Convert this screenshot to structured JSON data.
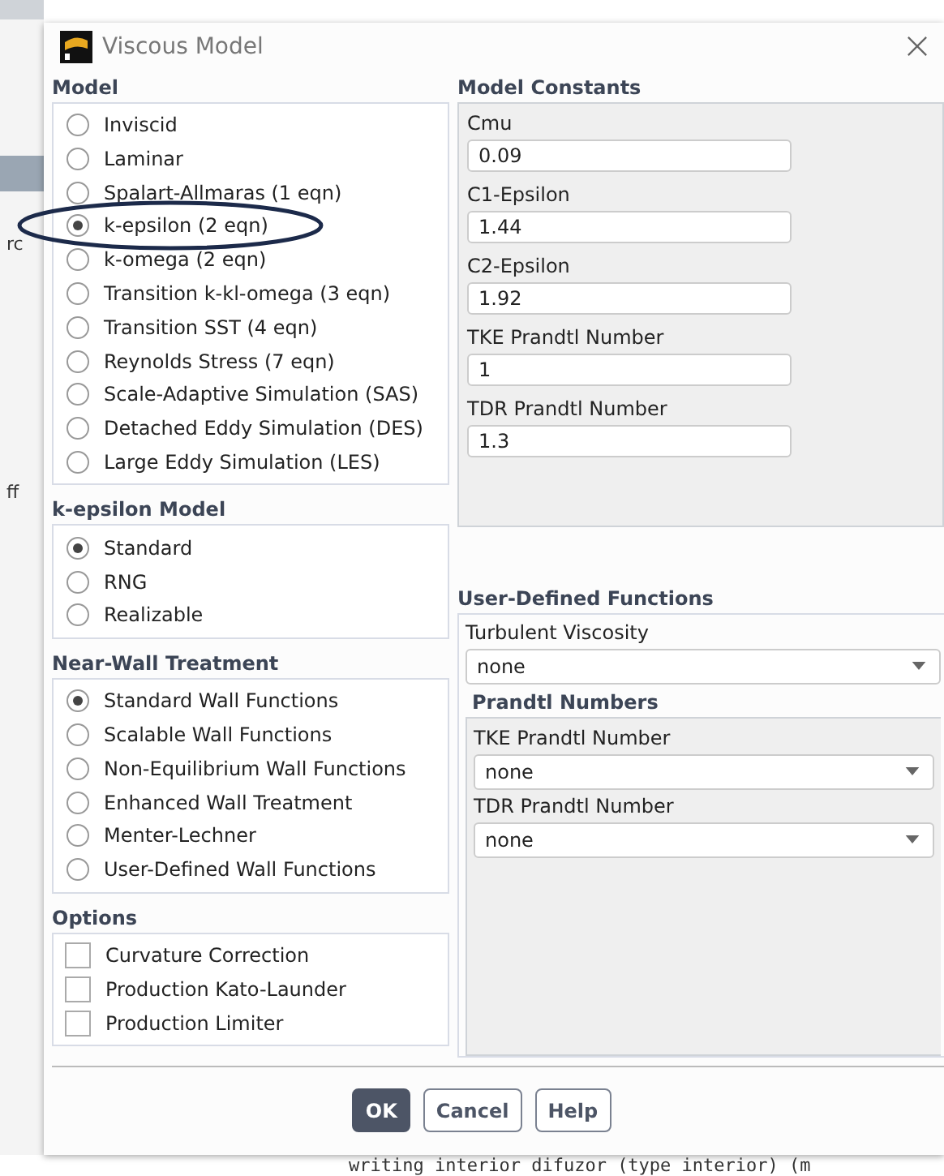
{
  "background": {
    "fragments": [
      "rc",
      "ff"
    ],
    "console_line": "writing interior difuzor (type interior) (m"
  },
  "window": {
    "title": "Viscous Model"
  },
  "model": {
    "title": "Model",
    "options": [
      {
        "label": "Inviscid",
        "selected": false,
        "circled": false
      },
      {
        "label": "Laminar",
        "selected": false,
        "circled": false
      },
      {
        "label": "Spalart-Allmaras (1 eqn)",
        "selected": false,
        "circled": false
      },
      {
        "label": "k-epsilon (2 eqn)",
        "selected": true,
        "circled": true
      },
      {
        "label": "k-omega (2 eqn)",
        "selected": false,
        "circled": false
      },
      {
        "label": "Transition k-kl-omega (3 eqn)",
        "selected": false,
        "circled": false
      },
      {
        "label": "Transition SST (4 eqn)",
        "selected": false,
        "circled": false
      },
      {
        "label": "Reynolds Stress (7 eqn)",
        "selected": false,
        "circled": false
      },
      {
        "label": "Scale-Adaptive Simulation (SAS)",
        "selected": false,
        "circled": false
      },
      {
        "label": "Detached Eddy Simulation (DES)",
        "selected": false,
        "circled": false
      },
      {
        "label": "Large Eddy Simulation (LES)",
        "selected": false,
        "circled": false
      }
    ]
  },
  "k_epsilon_model": {
    "title": "k-epsilon Model",
    "options": [
      {
        "label": "Standard",
        "selected": true
      },
      {
        "label": "RNG",
        "selected": false
      },
      {
        "label": "Realizable",
        "selected": false
      }
    ]
  },
  "near_wall_treatment": {
    "title": "Near-Wall Treatment",
    "options": [
      {
        "label": "Standard Wall Functions",
        "selected": true
      },
      {
        "label": "Scalable Wall Functions",
        "selected": false
      },
      {
        "label": "Non-Equilibrium Wall Functions",
        "selected": false
      },
      {
        "label": "Enhanced Wall Treatment",
        "selected": false
      },
      {
        "label": "Menter-Lechner",
        "selected": false
      },
      {
        "label": "User-Defined Wall Functions",
        "selected": false
      }
    ]
  },
  "options": {
    "title": "Options",
    "items": [
      {
        "label": "Curvature Correction",
        "checked": false
      },
      {
        "label": "Production Kato-Launder",
        "checked": false
      },
      {
        "label": "Production Limiter",
        "checked": false
      }
    ]
  },
  "model_constants": {
    "title": "Model Constants",
    "fields": [
      {
        "label": "Cmu",
        "value": "0.09"
      },
      {
        "label": "C1-Epsilon",
        "value": "1.44"
      },
      {
        "label": "C2-Epsilon",
        "value": "1.92"
      },
      {
        "label": "TKE Prandtl Number",
        "value": "1"
      },
      {
        "label": "TDR Prandtl Number",
        "value": "1.3"
      }
    ]
  },
  "user_defined_functions": {
    "title": "User-Defined Functions",
    "turbulent_viscosity": {
      "label": "Turbulent Viscosity",
      "value": "none"
    },
    "prandtl_numbers": {
      "title": "Prandtl Numbers",
      "fields": [
        {
          "label": "TKE Prandtl Number",
          "value": "none"
        },
        {
          "label": "TDR Prandtl Number",
          "value": "none"
        }
      ]
    }
  },
  "buttons": [
    {
      "label": "OK",
      "kind": "primary"
    },
    {
      "label": "Cancel",
      "kind": "plain"
    },
    {
      "label": "Help",
      "kind": "plain"
    }
  ]
}
